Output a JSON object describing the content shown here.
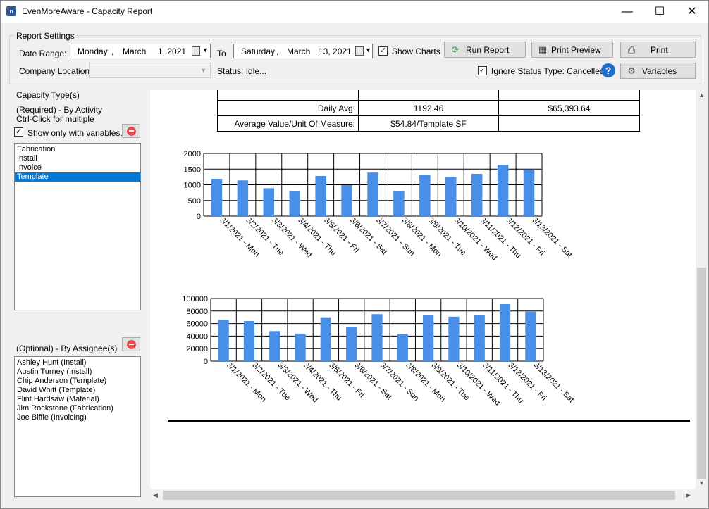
{
  "window": {
    "title": "EvenMoreAware - Capacity Report",
    "controls": {
      "minimize": "—",
      "maximize": "☐",
      "close": "✕"
    }
  },
  "settings": {
    "group_title": "Report Settings",
    "date_range_label": "Date Range:",
    "from": {
      "weekday": "Monday",
      "sep1": ",",
      "month": "March",
      "day_year": "1, 2021"
    },
    "to_label": "To",
    "to": {
      "weekday": "Saturday",
      "sep1": ",",
      "month": "March",
      "day_year": "13, 2021"
    },
    "show_charts": {
      "label": "Show Charts",
      "checked": true
    },
    "company_location_label": "Company Location",
    "company_location_value": "",
    "status": "Status: Idle...",
    "ignore_status": {
      "label": "Ignore Status Type: Cancelled",
      "checked": true
    },
    "buttons": {
      "run_report": "Run Report",
      "print_preview": "Print Preview",
      "print": "Print",
      "variables": "Variables"
    },
    "help": "?"
  },
  "capacity": {
    "title": "Capacity Type(s)",
    "required_text": "(Required) - By Activity",
    "ctrl_click_text": "Ctrl-Click for multiple",
    "show_only_with_variables": {
      "label": "Show only with variables.",
      "checked": true
    },
    "activities": [
      {
        "label": "Fabrication",
        "selected": false
      },
      {
        "label": "Install",
        "selected": false
      },
      {
        "label": "Invoice",
        "selected": false
      },
      {
        "label": "Template",
        "selected": true
      }
    ],
    "assignee_title": "(Optional) - By Assignee(s)",
    "assignees": [
      "Ashley Hunt (Install)",
      "Austin Turney (Install)",
      "Chip Anderson (Template)",
      "David Whitt (Template)",
      "Flint Hardsaw (Material)",
      "Jim Rockstone (Fabrication)",
      "Joe Biffle (Invoicing)"
    ]
  },
  "report": {
    "summary": [
      {
        "label": "Daily Avg:",
        "value1": "1192.46",
        "value2": "$65,393.64"
      },
      {
        "label": "Average Value/Unit Of Measure:",
        "value1": "$54.84/Template SF",
        "value2": ""
      }
    ]
  },
  "chart_data": [
    {
      "type": "bar",
      "categories": [
        "3/1/2021 - Mon",
        "3/2/2021 - Tue",
        "3/3/2021 - Wed",
        "3/4/2021 - Thu",
        "3/5/2021 - Fri",
        "3/6/2021 - Sat",
        "3/7/2021 - Sun",
        "3/8/2021 - Mon",
        "3/9/2021 - Tue",
        "3/10/2021 - Wed",
        "3/11/2021 - Thu",
        "3/12/2021 - Fri",
        "3/13/2021 - Sat"
      ],
      "values": [
        1190,
        1140,
        890,
        800,
        1280,
        990,
        1390,
        800,
        1320,
        1260,
        1350,
        1640,
        1490
      ],
      "yticks": [
        0,
        500,
        1000,
        1500,
        2000
      ],
      "ylim": [
        0,
        2000
      ],
      "grid": true,
      "bar_color": "#4a8fe7"
    },
    {
      "type": "bar",
      "categories": [
        "3/1/2021 - Mon",
        "3/2/2021 - Tue",
        "3/3/2021 - Wed",
        "3/4/2021 - Thu",
        "3/5/2021 - Fri",
        "3/6/2021 - Sat",
        "3/7/2021 - Sun",
        "3/8/2021 - Mon",
        "3/9/2021 - Tue",
        "3/10/2021 - Wed",
        "3/11/2021 - Thu",
        "3/12/2021 - Fri",
        "3/13/2021 - Sat"
      ],
      "values": [
        66000,
        64000,
        48000,
        44000,
        70000,
        55000,
        75000,
        43000,
        73000,
        71000,
        74000,
        91000,
        79000
      ],
      "yticks": [
        0,
        20000,
        40000,
        60000,
        80000,
        100000
      ],
      "ylim": [
        0,
        100000
      ],
      "grid": true,
      "bar_color": "#4a8fe7"
    }
  ]
}
